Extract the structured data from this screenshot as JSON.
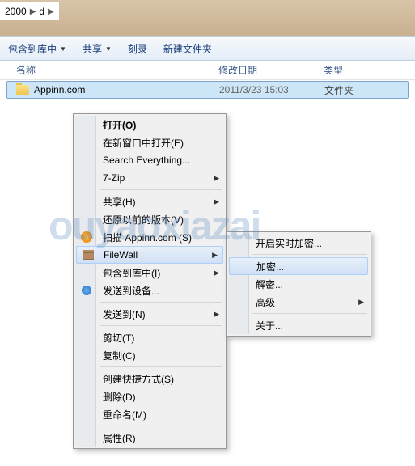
{
  "breadcrumb": {
    "part1": "2000",
    "part2": "d"
  },
  "toolbar": {
    "include": "包含到库中",
    "share": "共享",
    "burn": "刻录",
    "newfolder": "新建文件夹"
  },
  "columns": {
    "name": "名称",
    "date": "修改日期",
    "type": "类型"
  },
  "file": {
    "name": "Appinn.com",
    "date": "2011/3/23 15:03",
    "type": "文件夹"
  },
  "menu": {
    "open": "打开(O)",
    "open_new_window": "在新窗口中打开(E)",
    "search_everything": "Search Everything...",
    "seven_zip": "7-Zip",
    "share": "共享(H)",
    "restore": "还原以前的版本(V)",
    "scan": "扫描 Appinn.com (S)",
    "filewall": "FileWall",
    "include_lib": "包含到库中(I)",
    "send_device": "发送到设备...",
    "send_to": "发送到(N)",
    "cut": "剪切(T)",
    "copy": "复制(C)",
    "shortcut": "创建快捷方式(S)",
    "delete": "删除(D)",
    "rename": "重命名(M)",
    "properties": "属性(R)"
  },
  "submenu": {
    "realtime_enc": "开启实时加密...",
    "encrypt": "加密...",
    "decrypt": "解密...",
    "advanced": "高级",
    "about": "关于..."
  },
  "watermark": "ouyaoxiazai"
}
